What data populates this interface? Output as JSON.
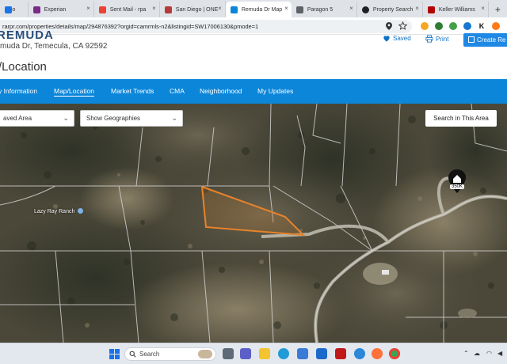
{
  "browser": {
    "tabs": [
      {
        "label": "io",
        "color": "#1a73e8"
      },
      {
        "label": "Experian",
        "color": "#7b2b89"
      },
      {
        "label": "Sent Mail - rpa",
        "color": "#ea4335"
      },
      {
        "label": "San Diego | ONE",
        "color": "#b63a3a"
      },
      {
        "label": "Remuda Dr Map",
        "color": "#0b86d9",
        "active": true
      },
      {
        "label": "Paragon 5",
        "color": "#5f6368"
      },
      {
        "label": "Property Search",
        "color": "#202124"
      },
      {
        "label": "Keller Williams",
        "color": "#b40101"
      }
    ],
    "new_tab_label": "+",
    "close_label": "×",
    "url": "rarpr.com/properties/details/map/294876392?orgid=camrmls-n2&listingid=SW17006130&pmode=1"
  },
  "header": {
    "cut_title": "REMUDA",
    "address": "muda Dr,  Temecula, CA 92592",
    "section_title": "/Location",
    "saved_label": "Saved",
    "print_label": "Print",
    "create_label": "Create Re"
  },
  "nav": {
    "items": [
      "y Information",
      "Map/Location",
      "Market Trends",
      "CMA",
      "Neighborhood",
      "My Updates"
    ],
    "active": "Map/Location"
  },
  "map": {
    "saved_area_label": "aved Area",
    "geographies_label": "Show Geographies",
    "search_button_label": "Search in This Area",
    "place_label": "Lazy Ray Ranch",
    "price_label": "350K",
    "parcel_outline_color": "#e8832a"
  },
  "taskbar": {
    "search_placeholder": "Search",
    "windows_icon": "windows-icon"
  }
}
